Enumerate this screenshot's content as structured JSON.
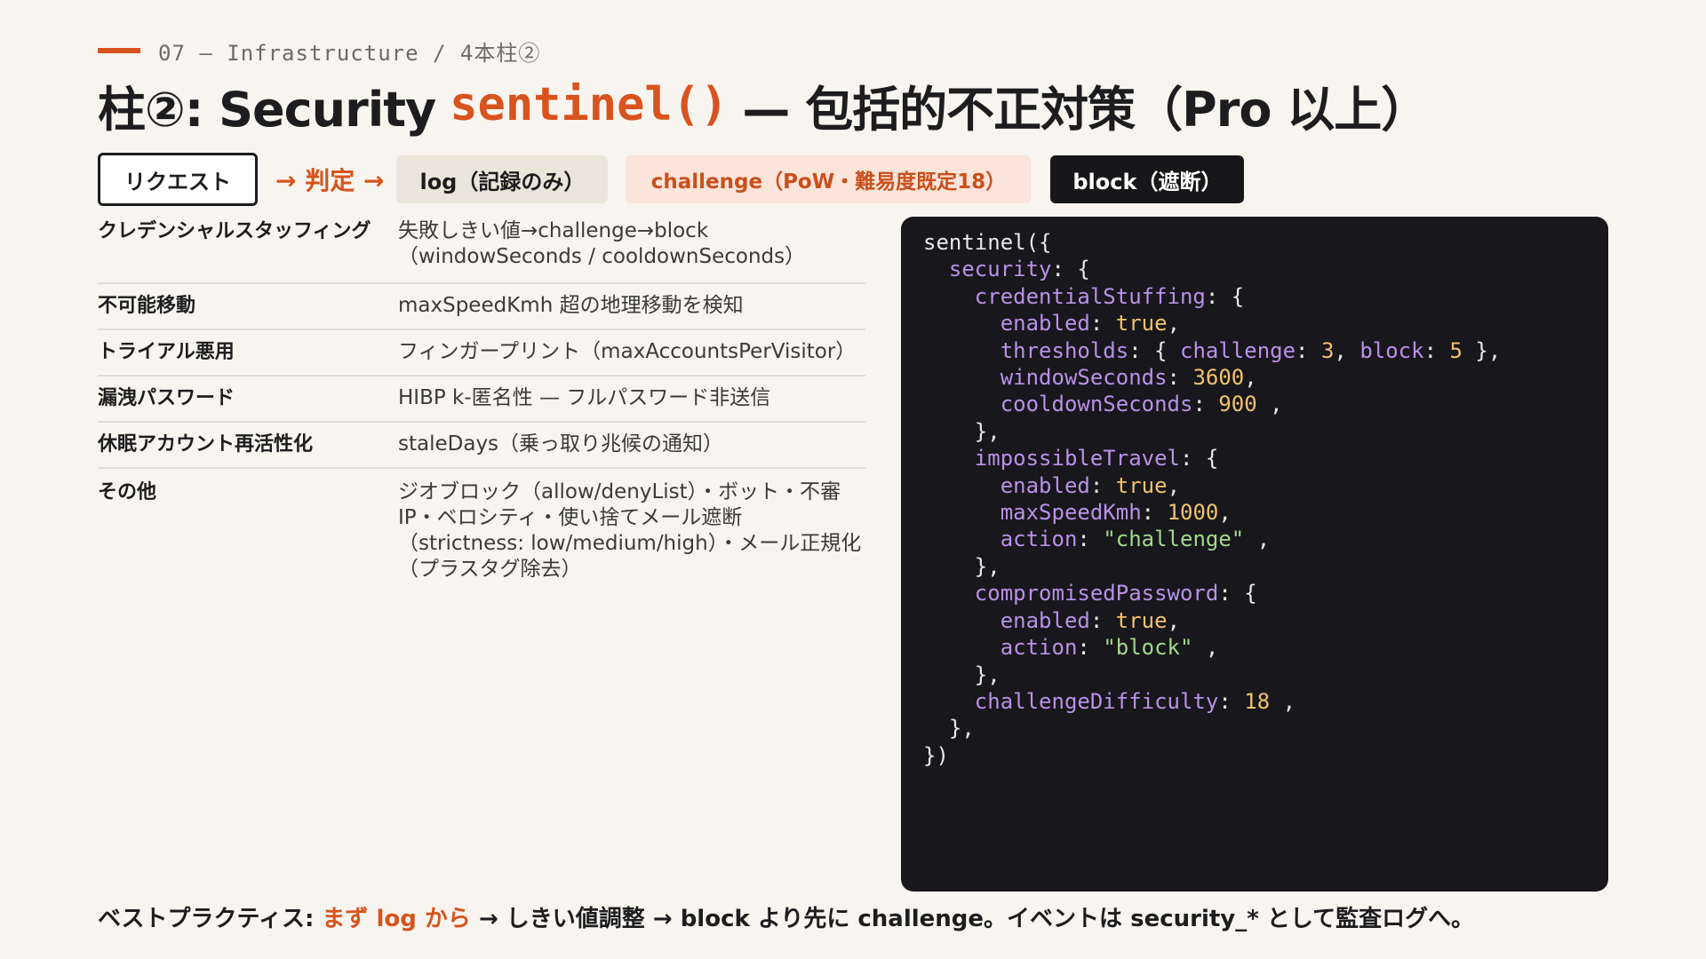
{
  "eyebrow": "07 — Infrastructure / 4本柱②",
  "title": {
    "prefix": "柱②: Security",
    "code": "sentinel()",
    "suffix": "— 包括的不正対策（Pro 以上）"
  },
  "flow": {
    "request": "リクエスト",
    "judge": "→ 判定 →",
    "log": "log（記録のみ）",
    "challenge": "challenge（PoW・難易度既定18）",
    "block": "block（遮断）"
  },
  "table": {
    "rows": [
      {
        "key": "クレデンシャルスタッフィング",
        "value": "失敗しきい値→challenge→block（windowSeconds / cooldownSeconds）"
      },
      {
        "key": "不可能移動",
        "value": "maxSpeedKmh 超の地理移動を検知"
      },
      {
        "key": "トライアル悪用",
        "value": "フィンガープリント（maxAccountsPerVisitor）"
      },
      {
        "key": "漏洩パスワード",
        "value": "HIBP k-匿名性 — フルパスワード非送信"
      },
      {
        "key": "休眠アカウント再活性化",
        "value": "staleDays（乗っ取り兆候の通知）"
      },
      {
        "key": "その他",
        "value": "ジオブロック（allow/denyList）・ボット・不審IP・ベロシティ・使い捨てメール遮断（strictness: low/medium/high）・メール正規化（プラスタグ除去）"
      }
    ]
  },
  "code": {
    "lines": [
      "sentinel({",
      "  security: {",
      "    credentialStuffing: {",
      "      enabled: true,",
      "      thresholds: { challenge: 3, block: 5 },",
      "      windowSeconds: 3600,",
      "      cooldownSeconds: 900 ,",
      "    },",
      "    impossibleTravel: {",
      "      enabled: true,",
      "      maxSpeedKmh: 1000,",
      "      action: \"challenge\" ,",
      "    },",
      "    compromisedPassword: {",
      "      enabled: true,",
      "      action: \"block\" ,",
      "    },",
      "    challengeDifficulty: 18 ,",
      "  },",
      "})"
    ]
  },
  "footer": {
    "lead": "ベストプラクティス: ",
    "highlight": "まず log から",
    "rest": " → しきい値調整 → block より先に challenge。イベントは security_* として監査ログへ。"
  },
  "colors": {
    "accent": "#d9531e",
    "background": "#f8f5f0",
    "code_bg": "#17171c",
    "code_key": "#b991e8",
    "code_number": "#f2c26b",
    "code_string": "#a4d88a"
  }
}
